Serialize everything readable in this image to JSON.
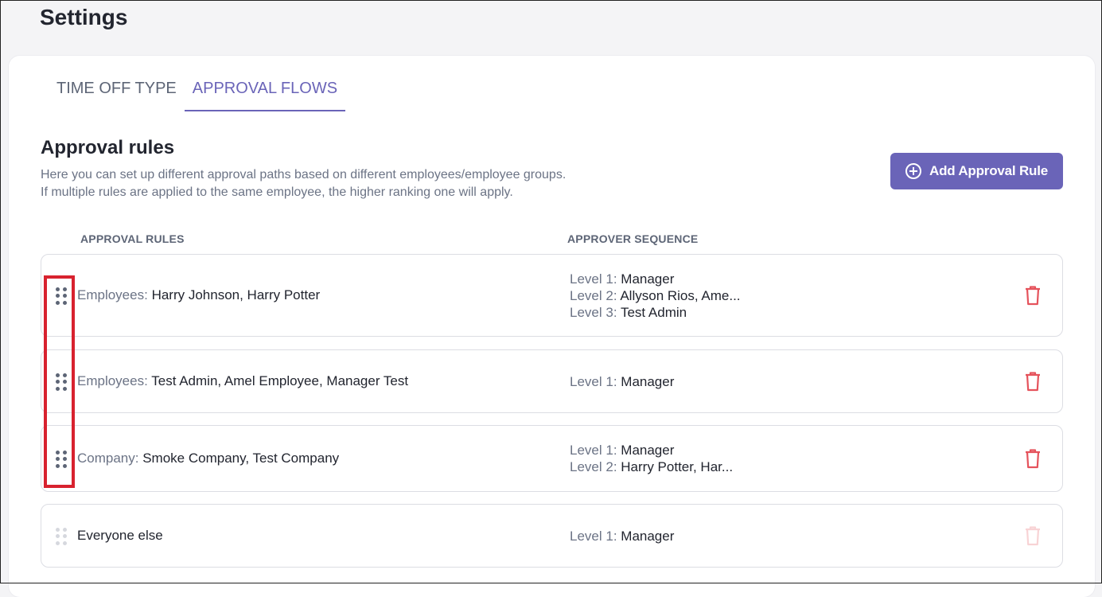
{
  "page": {
    "title": "Settings"
  },
  "tabs": [
    {
      "label": "TIME OFF TYPE",
      "active": false
    },
    {
      "label": "APPROVAL FLOWS",
      "active": true
    }
  ],
  "section": {
    "title": "Approval rules",
    "desc_line1": "Here you can set up different approval paths based on different employees/employee groups.",
    "desc_line2": "If multiple rules are applied to the same employee, the higher ranking one will apply.",
    "add_button": "Add Approval Rule"
  },
  "columns": {
    "rules": "APPROVAL RULES",
    "sequence": "APPROVER SEQUENCE"
  },
  "rows": [
    {
      "key": "Employees:",
      "value": "Harry Johnson, Harry Potter",
      "levels": [
        {
          "k": "Level 1:",
          "v": "Manager"
        },
        {
          "k": "Level 2:",
          "v": "Allyson Rios, Ame..."
        },
        {
          "k": "Level 3:",
          "v": "Test Admin"
        }
      ]
    },
    {
      "key": "Employees:",
      "value": "Test Admin, Amel Employee, Manager Test",
      "levels": [
        {
          "k": "Level 1:",
          "v": "Manager"
        }
      ]
    },
    {
      "key": "Company:",
      "value": "Smoke Company, Test Company",
      "levels": [
        {
          "k": "Level 1:",
          "v": "Manager"
        },
        {
          "k": "Level 2:",
          "v": "Harry Potter, Har..."
        }
      ]
    },
    {
      "key": "",
      "value": "Everyone else",
      "levels": [
        {
          "k": "Level 1:",
          "v": "Manager"
        }
      ]
    }
  ],
  "colors": {
    "accent": "#6a64b8",
    "danger": "#e5535c",
    "highlight": "#d8222f"
  },
  "icons": {
    "add": "plus-circle-icon",
    "drag": "drag-handle-icon",
    "delete": "trash-icon"
  }
}
